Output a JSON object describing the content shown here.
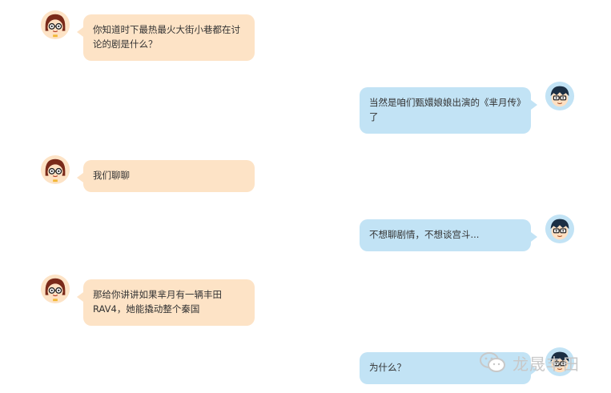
{
  "messages": [
    {
      "side": "left",
      "text": "你知道时下最热最火大街小巷都在讨论的剧是什么？"
    },
    {
      "side": "right",
      "text": "当然是咱们甄嬛娘娘出演的《芈月传》了"
    },
    {
      "side": "left",
      "text": "我们聊聊"
    },
    {
      "side": "right",
      "text": "不想聊剧情，不想谈宫斗..."
    },
    {
      "side": "left",
      "text": "那给你讲讲如果芈月有一辆丰田RAV4，她能撬动整个秦国"
    },
    {
      "side": "right",
      "text": "为什么？"
    }
  ],
  "watermark": {
    "text": "龙晟丰田",
    "icon": "wechat-icon"
  },
  "colors": {
    "left_bubble": "#fde3c6",
    "right_bubble": "#c2e3f5",
    "text": "#333333"
  }
}
